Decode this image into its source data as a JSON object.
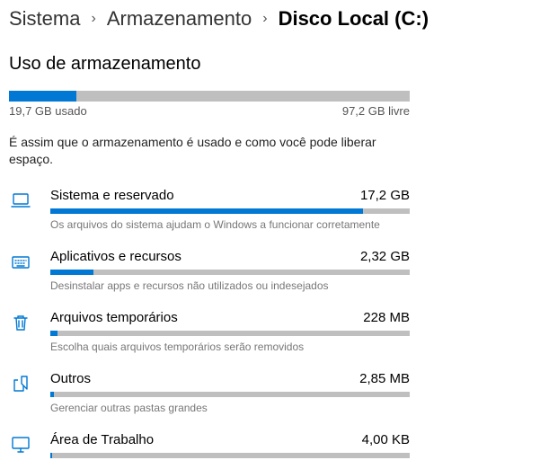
{
  "breadcrumb": {
    "items": [
      "Sistema",
      "Armazenamento",
      "Disco Local (C:)"
    ]
  },
  "section_title": "Uso de armazenamento",
  "overall": {
    "used_label": "19,7 GB usado",
    "free_label": "97,2 GB livre",
    "fill_percent": 16.85
  },
  "description": "É assim que o armazenamento é usado e como você pode liberar espaço.",
  "categories": [
    {
      "id": "system-reserved",
      "icon": "laptop-icon",
      "title": "Sistema e reservado",
      "size": "17,2 GB",
      "fill_percent": 87,
      "subtext": "Os arquivos do sistema ajudam o Windows a funcionar corretamente"
    },
    {
      "id": "apps-features",
      "icon": "keyboard-icon",
      "title": "Aplicativos e recursos",
      "size": "2,32 GB",
      "fill_percent": 12,
      "subtext": "Desinstalar apps e recursos não utilizados ou indesejados"
    },
    {
      "id": "temp-files",
      "icon": "trash-icon",
      "title": "Arquivos temporários",
      "size": "228 MB",
      "fill_percent": 2,
      "subtext": "Escolha quais arquivos temporários serão removidos"
    },
    {
      "id": "other",
      "icon": "folder-icon",
      "title": "Outros",
      "size": "2,85 MB",
      "fill_percent": 1,
      "subtext": "Gerenciar outras pastas grandes"
    },
    {
      "id": "desktop",
      "icon": "monitor-icon",
      "title": "Área de Trabalho",
      "size": "4,00 KB",
      "fill_percent": 0.5,
      "subtext": ""
    }
  ],
  "colors": {
    "accent": "#0078d4",
    "bar_bg": "#bfbfbf"
  }
}
